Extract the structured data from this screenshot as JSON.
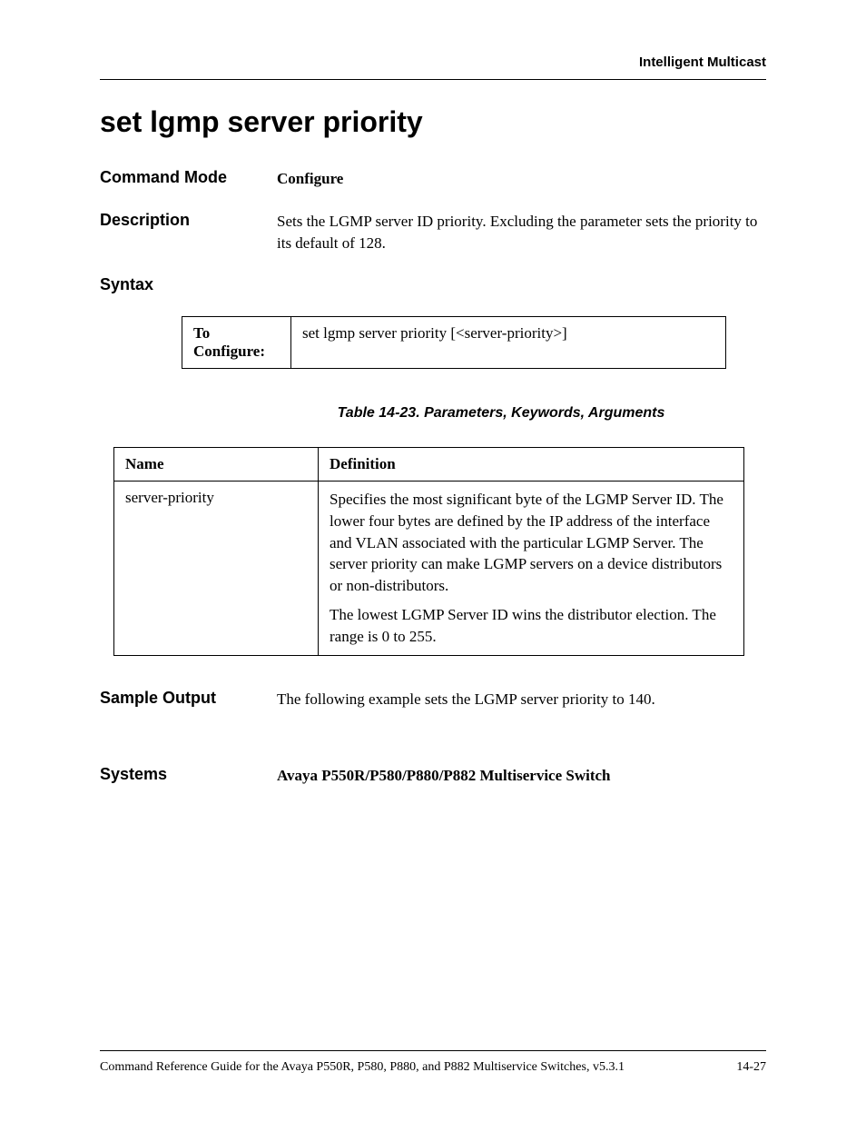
{
  "header": {
    "section": "Intelligent Multicast"
  },
  "title": "set lgmp server priority",
  "commandMode": {
    "label": "Command Mode",
    "value": "Configure"
  },
  "description": {
    "label": "Description",
    "value": "Sets the LGMP server ID priority. Excluding the parameter sets the priority to its default of 128."
  },
  "syntax": {
    "label": "Syntax",
    "tableLabel": "To Configure:",
    "tableValue": "set lgmp server priority [<server-priority>]"
  },
  "paramsCaption": "Table 14-23.  Parameters, Keywords, Arguments",
  "paramsHeaders": {
    "name": "Name",
    "definition": "Definition"
  },
  "paramsRows": [
    {
      "name": "server-priority",
      "def1": "Specifies the most significant byte of the LGMP Server ID. The lower four bytes are defined by the IP address of the interface and VLAN associated with the particular LGMP Server. The server priority can make LGMP servers on a device distributors or non-distributors.",
      "def2": "The lowest LGMP Server ID wins the distributor election. The range is 0 to 255."
    }
  ],
  "sampleOutput": {
    "label": "Sample Output",
    "value": "The following example sets the LGMP server priority to 140."
  },
  "systems": {
    "label": "Systems",
    "value": "Avaya P550R/P580/P880/P882 Multiservice Switch"
  },
  "footer": {
    "left": "Command Reference Guide for the Avaya P550R, P580, P880, and P882 Multiservice Switches, v5.3.1",
    "right": "14-27"
  }
}
